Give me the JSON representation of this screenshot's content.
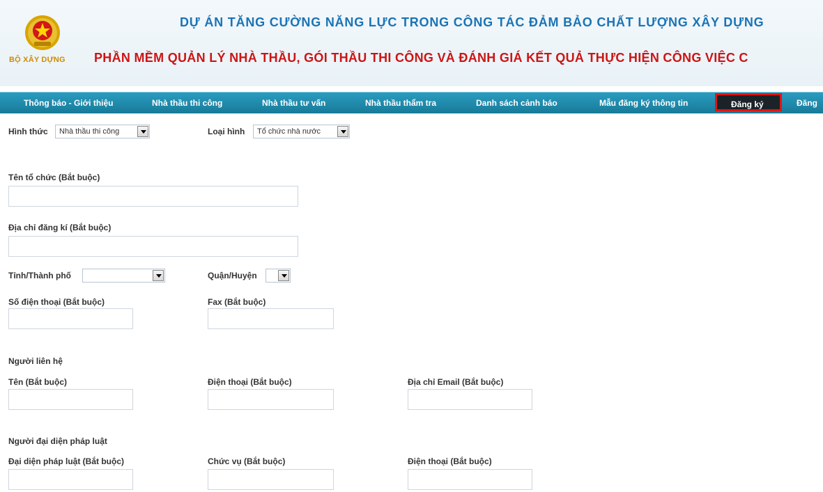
{
  "header": {
    "ministry": "BỘ XÂY DỰNG",
    "title_line1": "DỰ ÁN TĂNG CƯỜNG NĂNG LỰC TRONG CÔNG TÁC ĐẢM BẢO CHẤT LƯỢNG XÂY DỰNG",
    "title_line2": "PHẦN MỀM QUẢN LÝ NHÀ THẦU, GÓI THẦU THI CÔNG VÀ ĐÁNH GIÁ KẾT QUẢ THỰC HIỆN CÔNG VIỆC C"
  },
  "nav": {
    "items": [
      {
        "label": "Thông báo - Giới thiệu"
      },
      {
        "label": "Nhà thầu thi công"
      },
      {
        "label": "Nhà thầu tư vấn"
      },
      {
        "label": "Nhà thầu thẩm tra"
      },
      {
        "label": "Danh sách cảnh báo"
      },
      {
        "label": "Mẫu đăng ký thông tin"
      },
      {
        "label": "Đăng ký"
      },
      {
        "label": "Đăng"
      }
    ],
    "active_index": 6
  },
  "form": {
    "hinh_thuc": {
      "label": "Hình thức",
      "value": "Nhà thầu thi công"
    },
    "loai_hinh": {
      "label": "Loại hình",
      "value": "Tổ chức nhà nước"
    },
    "ten_to_chuc": {
      "label": "Tên tổ chức (Bắt buộc)",
      "value": ""
    },
    "dia_chi": {
      "label": "Địa chỉ đăng kí (Bắt buộc)",
      "value": ""
    },
    "tinh_thanh": {
      "label": "Tỉnh/Thành phố",
      "value": ""
    },
    "quan_huyen": {
      "label": "Quận/Huyện",
      "value": ""
    },
    "so_dien_thoai": {
      "label": "Số điện thoại (Bắt buộc)",
      "value": ""
    },
    "fax": {
      "label": "Fax (Bắt buộc)",
      "value": ""
    },
    "contact_section": "Người liên hệ",
    "contact_name": {
      "label": "Tên (Bắt buộc)",
      "value": ""
    },
    "contact_phone": {
      "label": "Điện thoại (Bắt buộc)",
      "value": ""
    },
    "contact_email": {
      "label": "Địa chỉ Email (Bắt buộc)",
      "value": ""
    },
    "legal_section": "Người đại diện pháp luật",
    "legal_rep": {
      "label": "Đại diện pháp luật (Bắt buộc)",
      "value": ""
    },
    "legal_position": {
      "label": "Chức vụ (Bắt buộc)",
      "value": ""
    },
    "legal_phone": {
      "label": "Điện thoại (Bắt buộc)",
      "value": ""
    }
  },
  "colors": {
    "nav_bg": "#1f8db0",
    "active_border": "#e01515",
    "title_blue": "#1a74b5",
    "title_red": "#cc1515"
  }
}
